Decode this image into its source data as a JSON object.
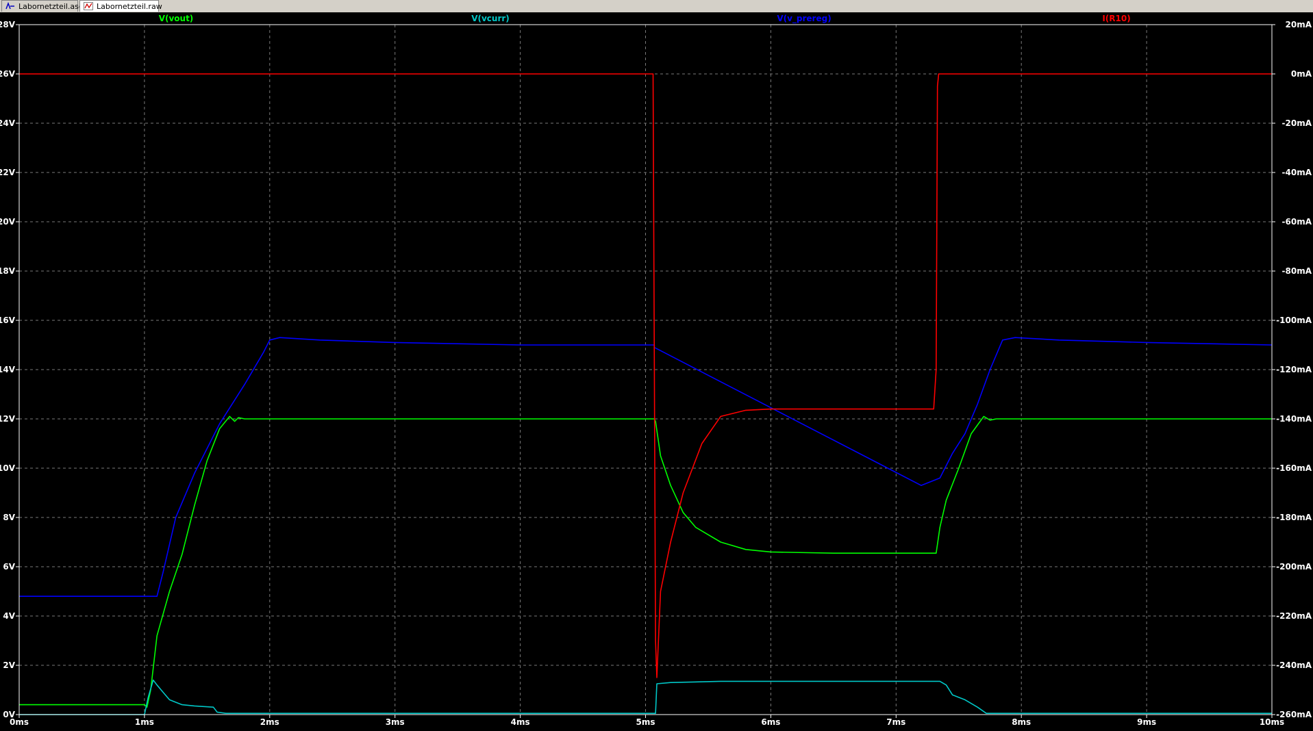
{
  "tabs": [
    {
      "label": "Labornetzteil.asc",
      "icon": "schematic-icon",
      "active": false
    },
    {
      "label": "Labornetzteil.raw",
      "icon": "waveform-icon",
      "active": true
    }
  ],
  "colors": {
    "background": "#000000",
    "frame": "#ffffff",
    "grid": "#7a7a7a",
    "axis_text": "#ffffff"
  },
  "chart_data": {
    "type": "line",
    "title": "",
    "xlabel": "",
    "ylabel": "",
    "y2label": "",
    "grid": true,
    "legend_placement": "top",
    "xlim": [
      0,
      10
    ],
    "ylim": [
      0,
      28
    ],
    "y2lim": [
      -260,
      20
    ],
    "x_tick_labels": [
      "0ms",
      "1ms",
      "2ms",
      "3ms",
      "4ms",
      "5ms",
      "6ms",
      "7ms",
      "8ms",
      "9ms",
      "10ms"
    ],
    "y_tick_labels": [
      "0V",
      "2V",
      "4V",
      "6V",
      "8V",
      "10V",
      "12V",
      "14V",
      "16V",
      "18V",
      "20V",
      "22V",
      "24V",
      "26V",
      "28V"
    ],
    "y2_tick_labels": [
      "-260mA",
      "-240mA",
      "-220mA",
      "-200mA",
      "-180mA",
      "-160mA",
      "-140mA",
      "-120mA",
      "-100mA",
      "-80mA",
      "-60mA",
      "-40mA",
      "-20mA",
      "0mA",
      "20mA"
    ],
    "series": [
      {
        "name": "V(vout)",
        "axis": "left",
        "color": "#00ff00",
        "points": [
          [
            0,
            0.4
          ],
          [
            1.0,
            0.4
          ],
          [
            1.02,
            0.3
          ],
          [
            1.05,
            1.0
          ],
          [
            1.1,
            3.2
          ],
          [
            1.2,
            5.0
          ],
          [
            1.3,
            6.5
          ],
          [
            1.4,
            8.5
          ],
          [
            1.5,
            10.3
          ],
          [
            1.6,
            11.6
          ],
          [
            1.68,
            12.1
          ],
          [
            1.72,
            11.9
          ],
          [
            1.75,
            12.05
          ],
          [
            1.8,
            12.0
          ],
          [
            5.07,
            12.0
          ],
          [
            5.08,
            11.9
          ],
          [
            5.12,
            10.5
          ],
          [
            5.2,
            9.3
          ],
          [
            5.3,
            8.2
          ],
          [
            5.4,
            7.6
          ],
          [
            5.6,
            7.0
          ],
          [
            5.8,
            6.7
          ],
          [
            6.0,
            6.6
          ],
          [
            6.5,
            6.55
          ],
          [
            7.32,
            6.55
          ],
          [
            7.35,
            7.6
          ],
          [
            7.4,
            8.7
          ],
          [
            7.5,
            10.0
          ],
          [
            7.6,
            11.4
          ],
          [
            7.7,
            12.1
          ],
          [
            7.75,
            11.95
          ],
          [
            7.8,
            12.0
          ],
          [
            10,
            12.0
          ]
        ]
      },
      {
        "name": "V(vcurr)",
        "axis": "left",
        "color": "#00c8c8",
        "points": [
          [
            0,
            0.0
          ],
          [
            1.0,
            0.0
          ],
          [
            1.03,
            0.7
          ],
          [
            1.07,
            1.4
          ],
          [
            1.1,
            1.2
          ],
          [
            1.15,
            0.9
          ],
          [
            1.2,
            0.6
          ],
          [
            1.3,
            0.4
          ],
          [
            1.4,
            0.35
          ],
          [
            1.55,
            0.3
          ],
          [
            1.58,
            0.1
          ],
          [
            1.65,
            0.05
          ],
          [
            5.08,
            0.05
          ],
          [
            5.09,
            1.25
          ],
          [
            5.2,
            1.3
          ],
          [
            5.6,
            1.35
          ],
          [
            7.35,
            1.35
          ],
          [
            7.4,
            1.2
          ],
          [
            7.45,
            0.8
          ],
          [
            7.55,
            0.6
          ],
          [
            7.65,
            0.3
          ],
          [
            7.72,
            0.05
          ],
          [
            10,
            0.05
          ]
        ]
      },
      {
        "name": "V(v_prereg)",
        "axis": "left",
        "color": "#0000ff",
        "points": [
          [
            0,
            4.8
          ],
          [
            1.1,
            4.8
          ],
          [
            1.15,
            5.8
          ],
          [
            1.25,
            8.0
          ],
          [
            1.4,
            9.8
          ],
          [
            1.6,
            11.8
          ],
          [
            1.8,
            13.4
          ],
          [
            1.95,
            14.7
          ],
          [
            2.0,
            15.2
          ],
          [
            2.08,
            15.3
          ],
          [
            2.4,
            15.2
          ],
          [
            3.0,
            15.1
          ],
          [
            4.0,
            15.0
          ],
          [
            5.07,
            15.0
          ],
          [
            5.07,
            14.9
          ],
          [
            7.2,
            9.3
          ],
          [
            7.35,
            9.6
          ],
          [
            7.45,
            10.6
          ],
          [
            7.55,
            11.4
          ],
          [
            7.65,
            12.6
          ],
          [
            7.75,
            14.0
          ],
          [
            7.85,
            15.2
          ],
          [
            7.95,
            15.3
          ],
          [
            8.3,
            15.2
          ],
          [
            9.0,
            15.1
          ],
          [
            10,
            15.0
          ]
        ]
      },
      {
        "name": "I(R10)",
        "axis": "right",
        "color": "#ff0000",
        "points": [
          [
            0,
            0
          ],
          [
            5.06,
            0
          ],
          [
            5.08,
            -230
          ],
          [
            5.09,
            -245
          ],
          [
            5.12,
            -210
          ],
          [
            5.2,
            -190
          ],
          [
            5.3,
            -170
          ],
          [
            5.45,
            -150
          ],
          [
            5.6,
            -139
          ],
          [
            5.8,
            -136.5
          ],
          [
            6.0,
            -136
          ],
          [
            7.3,
            -136
          ],
          [
            7.32,
            -120
          ],
          [
            7.33,
            -5
          ],
          [
            7.34,
            0
          ],
          [
            10,
            0
          ]
        ]
      }
    ]
  }
}
